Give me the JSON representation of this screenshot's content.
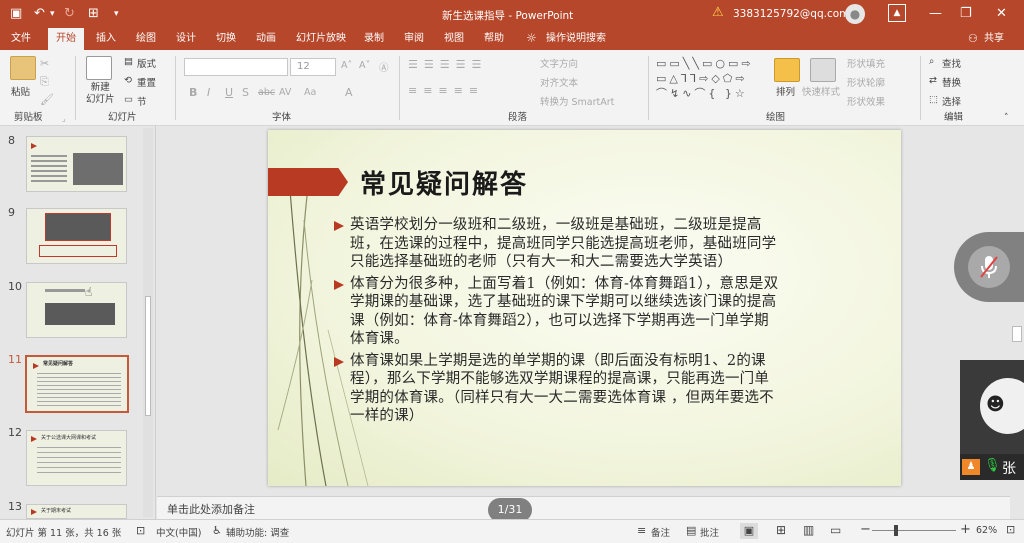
{
  "window": {
    "title": "新生选课指导 - PowerPoint",
    "user": "3383125792@qq.com"
  },
  "tabs": [
    "文件",
    "开始",
    "插入",
    "绘图",
    "设计",
    "切换",
    "动画",
    "幻灯片放映",
    "录制",
    "审阅",
    "视图",
    "帮助"
  ],
  "tell_me": "操作说明搜索",
  "share": "共享",
  "ribbon": {
    "clipboard": {
      "paste": "粘贴",
      "group": "剪贴板"
    },
    "slides": {
      "new_slide": "新建\n幻灯片",
      "layout": "版式",
      "reset": "重置",
      "section": "节",
      "group": "幻灯片"
    },
    "font": {
      "size": "12",
      "group": "字体",
      "buttons": [
        "B",
        "I",
        "U",
        "S",
        "abc",
        "AV",
        "Aa",
        "A"
      ]
    },
    "paragraph": {
      "text_direction": "文字方向",
      "align_text": "对齐文本",
      "smartart": "转换为 SmartArt",
      "group": "段落"
    },
    "drawing": {
      "arrange": "排列",
      "quick_styles": "快速样式",
      "fill": "形状填充",
      "outline": "形状轮廓",
      "effects": "形状效果",
      "group": "绘图"
    },
    "editing": {
      "find": "查找",
      "replace": "替换",
      "select": "选择",
      "group": "编辑"
    }
  },
  "thumbnails": [
    {
      "num": "8",
      "label": ""
    },
    {
      "num": "9",
      "label": ""
    },
    {
      "num": "10",
      "label": ""
    },
    {
      "num": "11",
      "label": "常见疑问解答"
    },
    {
      "num": "12",
      "label": "关于公选课大网课和考试"
    },
    {
      "num": "13",
      "label": "关于期末考试"
    }
  ],
  "slide": {
    "title": "常见疑问解答",
    "bullets": [
      "英语学校划分一级班和二级班，一级班是基础班，二级班是提高班，在选课的过程中，提高班同学只能选提高班老师，基础班同学只能选择基础班的老师（只有大一和大二需要选大学英语）",
      "体育分为很多种，上面写着1（例如：体育-体育舞蹈1），意思是双学期课的基础课，选了基础班的课下学期可以继续选该门课的提高课（例如：体育-体育舞蹈2），也可以选择下学期再选一门单学期体育课。",
      "体育课如果上学期是选的单学期的课（即后面没有标明1、2的课程），那么下学期不能够选双学期课程的提高课，只能再选一门单学期的体育课。（同样只有大一大二需要选体育课 ，但两年要选不一样的课）"
    ]
  },
  "notes_placeholder": "单击此处添加备注",
  "page_indicator": "1/31",
  "status": {
    "slide_info": "幻灯片 第 11 张，共 16 张",
    "language": "中文(中国)",
    "accessibility": "辅助功能: 调查",
    "notes": "备注",
    "comments": "批注",
    "zoom": "62%",
    "zoom_level": 0.62
  },
  "participant": {
    "name": "张"
  },
  "colors": {
    "accent": "#b7472a",
    "slide_red": "#b83a22"
  }
}
